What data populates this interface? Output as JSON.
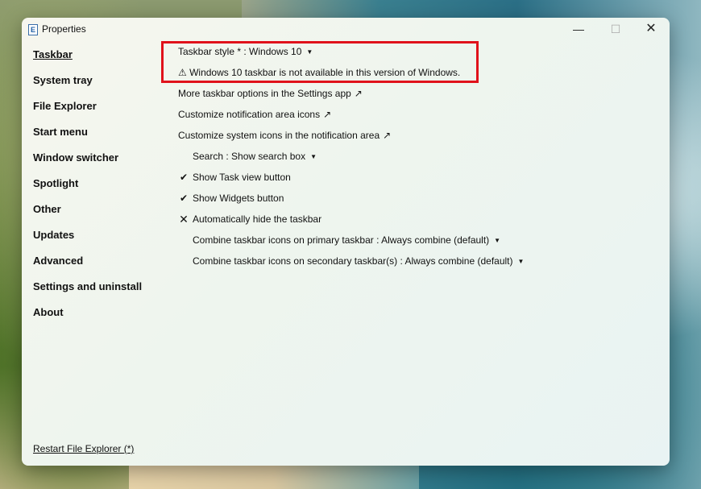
{
  "window": {
    "title": "Properties",
    "controls": {
      "minimize": "—",
      "maximize": "☐",
      "close": "✕"
    }
  },
  "sidebar": {
    "items": [
      {
        "label": "Taskbar",
        "active": true
      },
      {
        "label": "System tray"
      },
      {
        "label": "File Explorer"
      },
      {
        "label": "Start menu"
      },
      {
        "label": "Window switcher"
      },
      {
        "label": "Spotlight"
      },
      {
        "label": "Other"
      },
      {
        "label": "Updates"
      },
      {
        "label": "Advanced"
      },
      {
        "label": "Settings and uninstall"
      },
      {
        "label": "About"
      }
    ],
    "restart_label": "Restart File Explorer (*)"
  },
  "content": {
    "taskbar_style": {
      "label": "Taskbar style * : Windows 10",
      "dropdown": "▼"
    },
    "warning": "⚠ Windows 10 taskbar is not available in this version of Windows.",
    "links": [
      {
        "label": "More taskbar options in the Settings app",
        "icon": "↗"
      },
      {
        "label": "Customize notification area icons",
        "icon": "↗"
      },
      {
        "label": "Customize system icons in the notification area",
        "icon": "↗"
      }
    ],
    "search": {
      "label": "Search : Show search box",
      "dropdown": "▼"
    },
    "task_view": {
      "label": "Show Task view button",
      "mark": "✔"
    },
    "widgets": {
      "label": "Show Widgets button",
      "mark": "✔"
    },
    "auto_hide": {
      "label": "Automatically hide the taskbar",
      "mark": "✕"
    },
    "combine_primary": {
      "label": "Combine taskbar icons on primary taskbar : Always combine (default)",
      "dropdown": "▼"
    },
    "combine_secondary": {
      "label": "Combine taskbar icons on secondary taskbar(s) : Always combine (default)",
      "dropdown": "▼"
    }
  },
  "colors": {
    "highlight": "#e0121b"
  }
}
